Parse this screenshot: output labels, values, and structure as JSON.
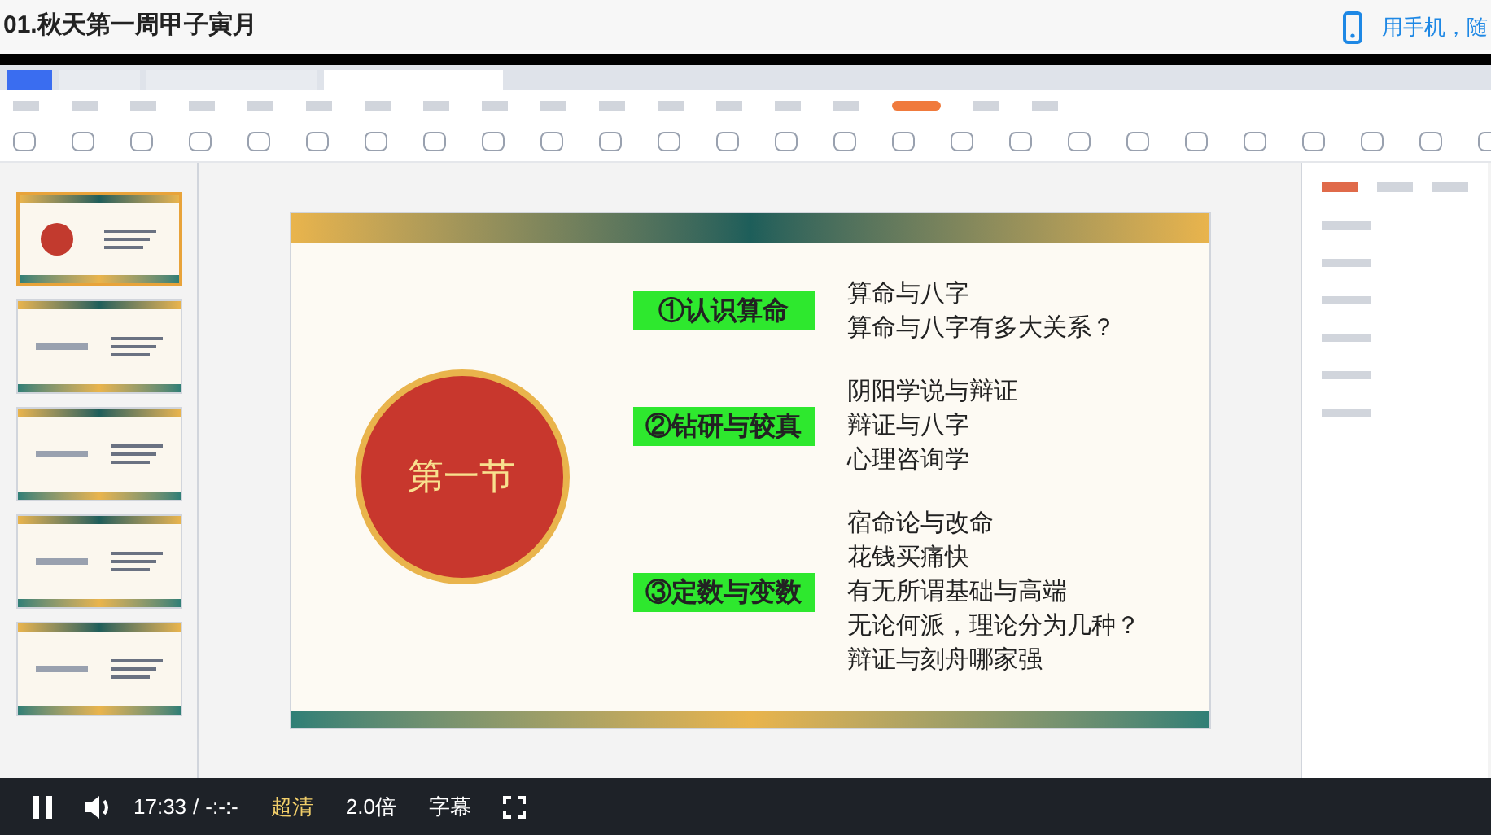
{
  "page_title": "01.秋天第一周甲子寅月",
  "mobile_link": "用手机，随",
  "slide": {
    "circle_title": "第一节",
    "sections": [
      {
        "label": "①认识算命",
        "items": [
          "算命与八字",
          "算命与八字有多大关系？"
        ]
      },
      {
        "label": "②钻研与较真",
        "items": [
          "阴阳学说与辩证",
          "辩证与八字",
          "心理咨询学"
        ]
      },
      {
        "label": "③定数与变数",
        "items": [
          "宿命论与改命",
          "花钱买痛快",
          "有无所谓基础与高端",
          "无论何派，理论分为几种？",
          "辩证与刻舟哪家强"
        ]
      }
    ]
  },
  "player": {
    "playing": true,
    "current_time": "17:33",
    "separator": "/",
    "duration": "-:-:-",
    "quality": "超清",
    "speed": "2.0倍",
    "subtitles": "字幕"
  }
}
